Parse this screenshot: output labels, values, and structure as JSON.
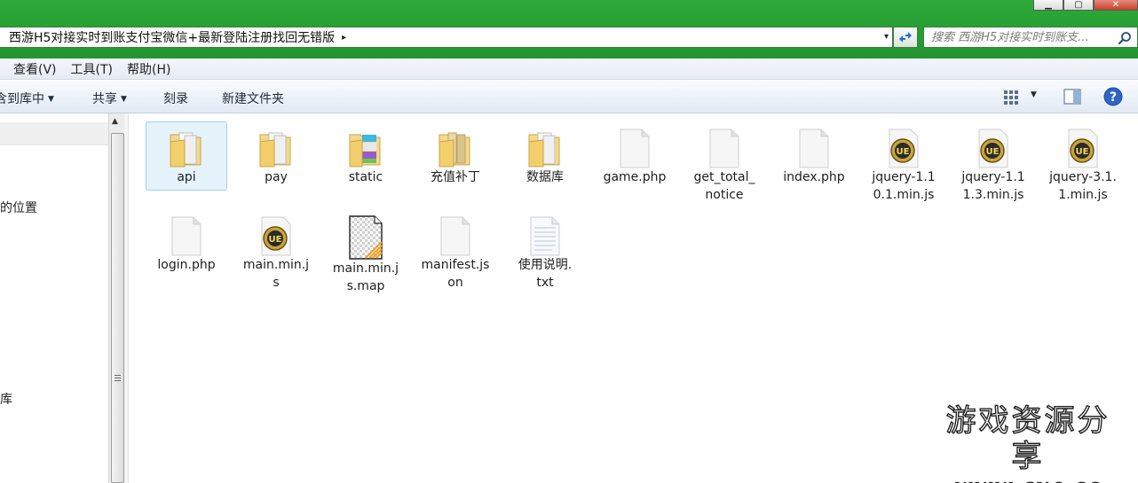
{
  "window": {
    "minimize_label": "▁",
    "maximize_label": "▢",
    "close_label": "✕"
  },
  "address": {
    "path": "西游H5对接实时到账支付宝微信+最新登陆注册找回无错版",
    "separator": "▸",
    "dropdown": "▾"
  },
  "search": {
    "placeholder": "搜索 西游H5对接实时到账支..."
  },
  "menu": [
    {
      "label": "查看(V)"
    },
    {
      "label": "工具(T)"
    },
    {
      "label": "帮助(H)"
    }
  ],
  "toolbar": {
    "include_library": "含到库中",
    "share": "共享",
    "burn": "刻录",
    "new_folder": "新建文件夹"
  },
  "nav": {
    "item_places": "的位置",
    "item_library": "库"
  },
  "files": [
    {
      "name": "api",
      "type": "folder"
    },
    {
      "name": "pay",
      "type": "folder"
    },
    {
      "name": "static",
      "type": "folder"
    },
    {
      "name": "充值补丁",
      "type": "folder"
    },
    {
      "name": "数据库",
      "type": "folder"
    },
    {
      "name": "game.php",
      "type": "file"
    },
    {
      "name": "get_total_\nnotice",
      "type": "file"
    },
    {
      "name": "index.php",
      "type": "file"
    },
    {
      "name": "jquery-1.1\n0.1.min.js",
      "type": "ue"
    },
    {
      "name": "jquery-1.1\n1.3.min.js",
      "type": "ue"
    },
    {
      "name": "jquery-3.1.\n1.min.js",
      "type": "ue"
    },
    {
      "name": "login.php",
      "type": "file"
    },
    {
      "name": "main.min.j\ns",
      "type": "ue"
    },
    {
      "name": "main.min.j\ns.map",
      "type": "map"
    },
    {
      "name": "manifest.js\non",
      "type": "file"
    },
    {
      "name": "使用说明.\ntxt",
      "type": "txt"
    }
  ],
  "watermark": {
    "line1": "游戏资源分享",
    "line2": "www.guo.cc"
  },
  "colors": {
    "chrome_green": "#27a033",
    "selection": "#e5f3fb",
    "folder": "#f2cf6a"
  }
}
